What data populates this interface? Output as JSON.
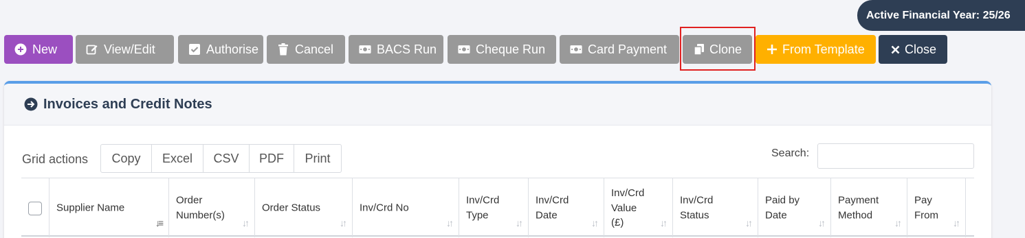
{
  "header": {
    "financial_year": "Active Financial Year: 25/26"
  },
  "toolbar": {
    "new": "New",
    "view_edit": "View/Edit",
    "authorise": "Authorise",
    "cancel": "Cancel",
    "bacs_run": "BACS Run",
    "cheque_run": "Cheque Run",
    "card_payment": "Card Payment",
    "clone": "Clone",
    "from_template": "From Template",
    "close": "Close"
  },
  "colors": {
    "purple": "#9b4fc0",
    "gray": "#999999",
    "amber": "#ffb000",
    "navy": "#2e3e54",
    "accent_blue": "#5a9ee8",
    "highlight_red": "#e02020"
  },
  "card": {
    "title": "Invoices and Credit Notes"
  },
  "grid_actions": {
    "label": "Grid actions",
    "buttons": [
      "Copy",
      "Excel",
      "CSV",
      "PDF",
      "Print"
    ]
  },
  "search": {
    "label": "Search:",
    "value": ""
  },
  "table": {
    "columns": [
      {
        "l1": "Supplier Name",
        "l2": "",
        "l3": ""
      },
      {
        "l1": "Order",
        "l2": "Number(s)",
        "l3": ""
      },
      {
        "l1": "Order Status",
        "l2": "",
        "l3": ""
      },
      {
        "l1": "Inv/Crd No",
        "l2": "",
        "l3": ""
      },
      {
        "l1": "Inv/Crd",
        "l2": "Type",
        "l3": ""
      },
      {
        "l1": "Inv/Crd",
        "l2": "Date",
        "l3": ""
      },
      {
        "l1": "Inv/Crd",
        "l2": "Value",
        "l3": "(£)"
      },
      {
        "l1": "Inv/Crd",
        "l2": "Status",
        "l3": ""
      },
      {
        "l1": "Paid by",
        "l2": "Date",
        "l3": ""
      },
      {
        "l1": "Payment",
        "l2": "Method",
        "l3": ""
      },
      {
        "l1": "Pay",
        "l2": "From",
        "l3": ""
      }
    ]
  }
}
